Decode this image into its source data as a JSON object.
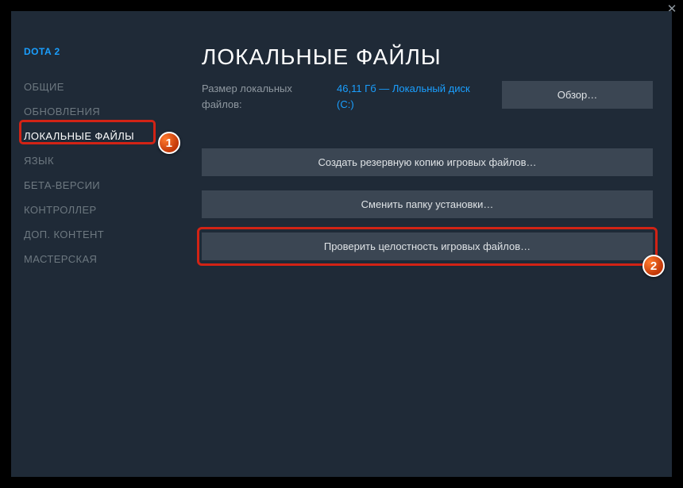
{
  "game_title": "DOTA 2",
  "close_glyph": "✕",
  "sidebar": {
    "items": [
      {
        "label": "ОБЩИЕ"
      },
      {
        "label": "ОБНОВЛЕНИЯ"
      },
      {
        "label": "ЛОКАЛЬНЫЕ ФАЙЛЫ",
        "active": true
      },
      {
        "label": "ЯЗЫК"
      },
      {
        "label": "БЕТА-ВЕРСИИ"
      },
      {
        "label": "КОНТРОЛЛЕР"
      },
      {
        "label": "ДОП. КОНТЕНТ"
      },
      {
        "label": "МАСТЕРСКАЯ"
      }
    ]
  },
  "main": {
    "title": "ЛОКАЛЬНЫЕ ФАЙЛЫ",
    "size_label": "Размер локальных файлов:",
    "size_value": "46,11 Гб — Локальный диск (C:)",
    "browse_label": "Обзор…",
    "buttons": {
      "backup": "Создать резервную копию игровых файлов…",
      "move": "Сменить папку установки…",
      "verify": "Проверить целостность игровых файлов…"
    }
  },
  "annotations": {
    "badge1": "1",
    "badge2": "2"
  }
}
